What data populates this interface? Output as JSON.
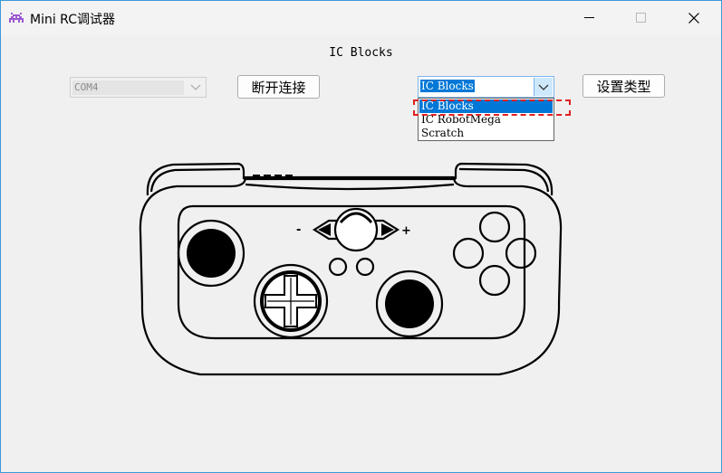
{
  "window": {
    "title": "Mini RC调试器",
    "app_icon": "invader-icon",
    "controls": [
      "minimize-icon",
      "maximize-icon",
      "close-icon"
    ]
  },
  "header": {
    "text": "IC Blocks"
  },
  "port_select": {
    "value": "COM4",
    "enabled": false
  },
  "connect_button": {
    "label": "断开连接"
  },
  "type_select": {
    "value": "IC Blocks",
    "options": [
      "IC Blocks",
      "IC RobotMega",
      "Scratch"
    ],
    "selected_index": 0,
    "open": true
  },
  "set_type_button": {
    "label": "设置类型"
  },
  "colors": {
    "accent": "#0078d7",
    "highlight_dash": "#e02020",
    "window_border": "#3a9ad9"
  },
  "controller": {
    "image": "gamepad-diagram",
    "dpad": "dpad-icon",
    "left_right_indicator": [
      "minus",
      "plus"
    ]
  }
}
